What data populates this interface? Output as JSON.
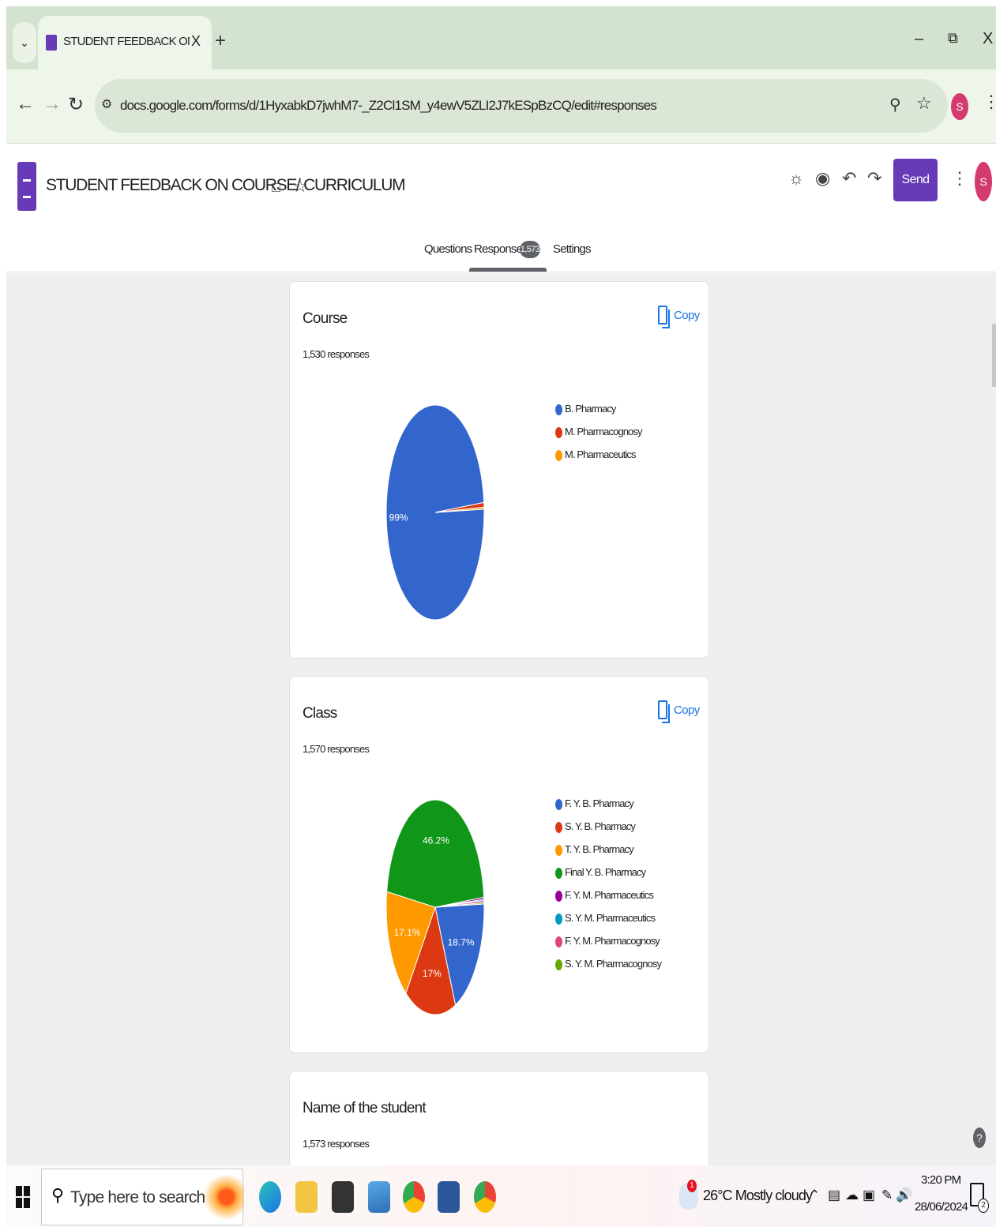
{
  "browser": {
    "tab_title": "STUDENT FEEDBACK ON COUR",
    "tab_close": "X",
    "new_tab": "+",
    "tab_menu": "⌄",
    "url": "docs.google.com/forms/d/1HyxabkD7jwhM7-_Z2Cl1SM_y4ewV5ZLI2J7kESpBzCQ/edit#responses",
    "profile_initial": "S",
    "window_min": "–",
    "window_max": "⧉",
    "window_close": "X"
  },
  "form": {
    "title": "STUDENT FEEDBACK ON COURSE/ CURRICULUM",
    "send_label": "Send",
    "avatar_initial": "S",
    "tabs": [
      {
        "label": "Questions"
      },
      {
        "label": "Responses"
      },
      {
        "label": "Settings"
      }
    ],
    "responses_badge": "1,573"
  },
  "cards": [
    {
      "title": "Course",
      "subtitle": "1,530 responses",
      "copy_label": "Copy",
      "chart_data": {
        "type": "pie",
        "labels": [
          "B. Pharmacy",
          "M. Pharmacognosy",
          "M. Pharmaceutics"
        ],
        "values": [
          99,
          0.7,
          0.3
        ],
        "value_labels": [
          "99%",
          "",
          ""
        ],
        "colors": [
          "#3366cc",
          "#dc3912",
          "#ff9900"
        ]
      }
    },
    {
      "title": "Class",
      "subtitle": "1,570 responses",
      "copy_label": "Copy",
      "chart_data": {
        "type": "pie",
        "labels": [
          "F. Y. B. Pharmacy",
          "S. Y. B. Pharmacy",
          "T. Y. B. Pharmacy",
          "Final Y. B. Pharmacy",
          "F. Y. M. Pharmaceutics",
          "S. Y. M. Pharmaceutics",
          "F. Y. M. Pharmacognosy",
          "S. Y. M. Pharmacognosy"
        ],
        "values": [
          18.7,
          17,
          17.1,
          46.2,
          0.3,
          0.2,
          0.3,
          0.2
        ],
        "value_labels": [
          "18.7%",
          "17%",
          "17.1%",
          "46.2%",
          "",
          "",
          "",
          ""
        ],
        "colors": [
          "#3366cc",
          "#dc3912",
          "#ff9900",
          "#109618",
          "#990099",
          "#0099c6",
          "#dd4477",
          "#66aa00"
        ]
      }
    },
    {
      "title": "Name of the student",
      "subtitle": "1,573 responses"
    }
  ],
  "taskbar": {
    "search_placeholder": "Type here to search",
    "weather": "26°C  Mostly cloudy",
    "weather_badge": "1",
    "time": "3:20 PM",
    "date": "28/06/2024",
    "notification_count": "2"
  }
}
